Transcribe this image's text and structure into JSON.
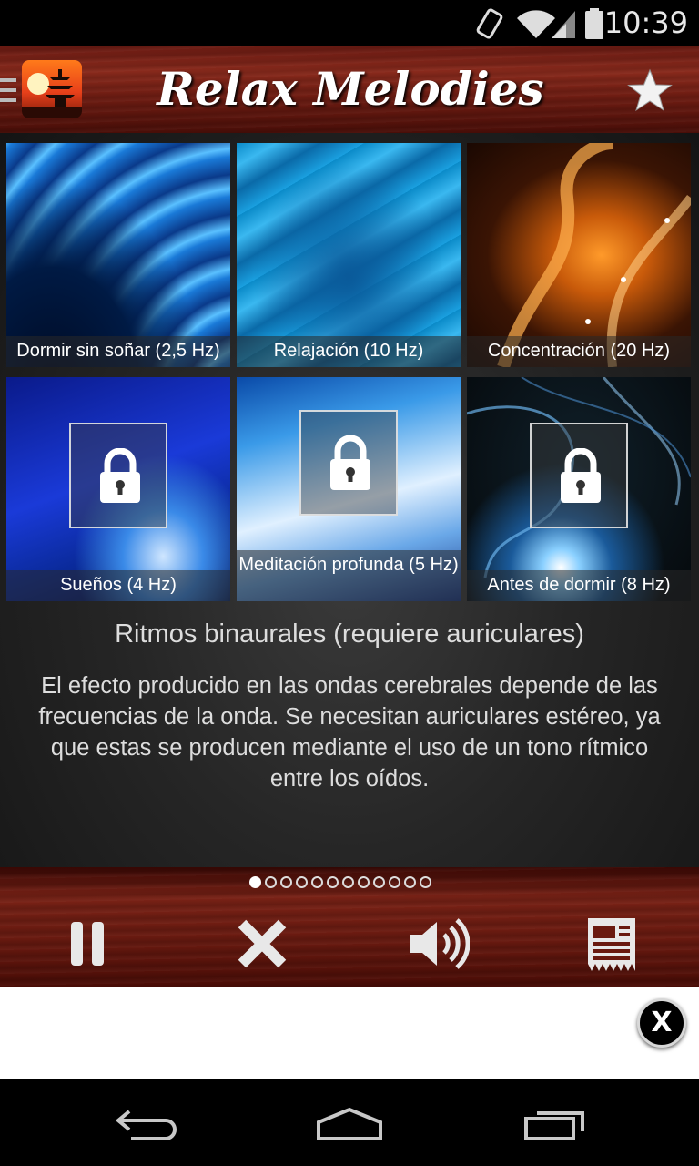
{
  "status_bar": {
    "time": "10:39"
  },
  "header": {
    "title": "Relax Melodies"
  },
  "tiles": [
    {
      "label": "Dormir sin soñar (2,5 Hz)",
      "locked": false
    },
    {
      "label": "Relajación (10 Hz)",
      "locked": false
    },
    {
      "label": "Concentración (20 Hz)",
      "locked": false
    },
    {
      "label": "Sueños (4 Hz)",
      "locked": true
    },
    {
      "label": "Meditación profunda (5 Hz)",
      "locked": true
    },
    {
      "label": "Antes de dormir (8 Hz)",
      "locked": true
    }
  ],
  "info": {
    "title": "Ritmos binaurales (requiere auriculares)",
    "description": "El efecto producido en las ondas cerebrales depende de las frecuencias de la onda. Se necesitan auriculares estéreo, ya que estas se producen mediante el uso de un tono rítmico entre los oídos."
  },
  "pager": {
    "page_count": 12,
    "active_index": 0
  },
  "ad": {
    "close_label": "X"
  },
  "colors": {
    "header_wood": "#6e1c12",
    "background": "#262626"
  },
  "icons": [
    "phone-rotate-icon",
    "wifi-icon",
    "signal-icon",
    "battery-icon",
    "menu-icon",
    "app-logo-icon",
    "star-icon",
    "lock-icon",
    "pause-icon",
    "close-icon",
    "volume-icon",
    "timer-icon",
    "back-icon",
    "home-icon",
    "recents-icon"
  ]
}
